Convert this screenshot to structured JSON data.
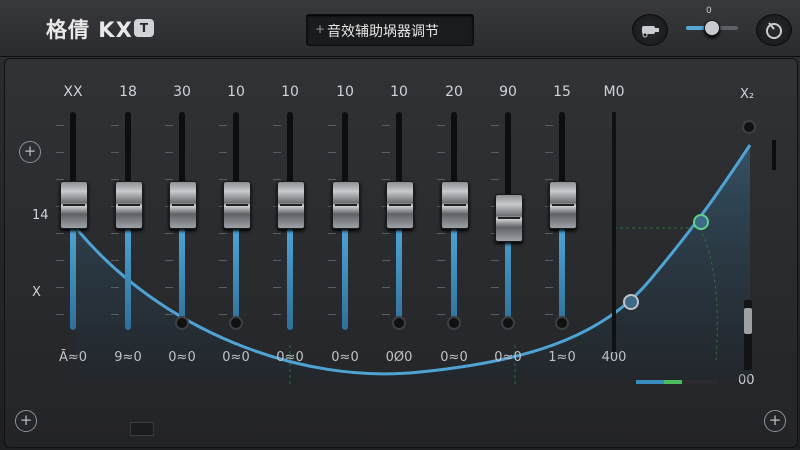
{
  "app": {
    "logo_text": "格倩 KX",
    "logo_badge": "T",
    "title_prefix": "+",
    "title": "音效辅助埚器调节"
  },
  "controls": {
    "mini_slider_label": "0",
    "mini_slider_level": 0.45
  },
  "side_labels": {
    "left_upper": "14",
    "left_lower": "X",
    "right_top": "X₂",
    "right_bottom": "00"
  },
  "eq_bands": [
    {
      "top": "XX",
      "bottom": "Ā≈0",
      "gain": 0.58
    },
    {
      "top": "18",
      "bottom": "9≈0",
      "gain": 0.58
    },
    {
      "top": "30",
      "bottom": "0≈0",
      "gain": 0.58
    },
    {
      "top": "10",
      "bottom": "0≈0",
      "gain": 0.58
    },
    {
      "top": "10",
      "bottom": "0≈0",
      "gain": 0.58
    },
    {
      "top": "10",
      "bottom": "0≈0",
      "gain": 0.58
    },
    {
      "top": "10",
      "bottom": "0Ø0",
      "gain": 0.58
    },
    {
      "top": "20",
      "bottom": "0≈0",
      "gain": 0.58
    },
    {
      "top": "90",
      "bottom": "0≈0",
      "gain": 0.52
    },
    {
      "top": "15",
      "bottom": "1≈0",
      "gain": 0.58
    }
  ],
  "master": {
    "top": "M0",
    "bottom": "400"
  },
  "colors": {
    "accent": "#4ea3d3",
    "level_green": "#4bbd5d"
  },
  "icons": [
    "plus-circle-icon",
    "car-icon",
    "power-icon"
  ]
}
